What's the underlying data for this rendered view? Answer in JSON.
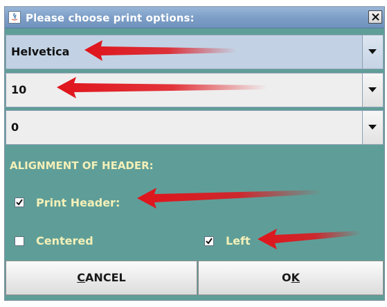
{
  "window": {
    "title": "Please choose print options:"
  },
  "font_combo": {
    "value": "Helvetica"
  },
  "size_combo": {
    "value": "10"
  },
  "third_combo": {
    "value": "0"
  },
  "alignment": {
    "section_label": "ALIGNMENT OF HEADER:",
    "print_header": {
      "label": "Print Header:",
      "checked": true
    },
    "centered": {
      "label": "Centered",
      "checked": false
    },
    "left": {
      "label": "Left",
      "checked": true
    }
  },
  "buttons": {
    "cancel": {
      "mnemonic": "C",
      "rest": "ANCEL"
    },
    "ok": {
      "pre": "O",
      "mnemonic": "K"
    }
  },
  "colors": {
    "dialog_background": "#5f9e98",
    "label_text": "#f4f0b8",
    "annotation_arrow": "#e0141b"
  },
  "icons": [
    "java-app-icon",
    "close-icon",
    "dropdown-arrow-icon",
    "checkmark-icon",
    "annotation-arrow"
  ]
}
